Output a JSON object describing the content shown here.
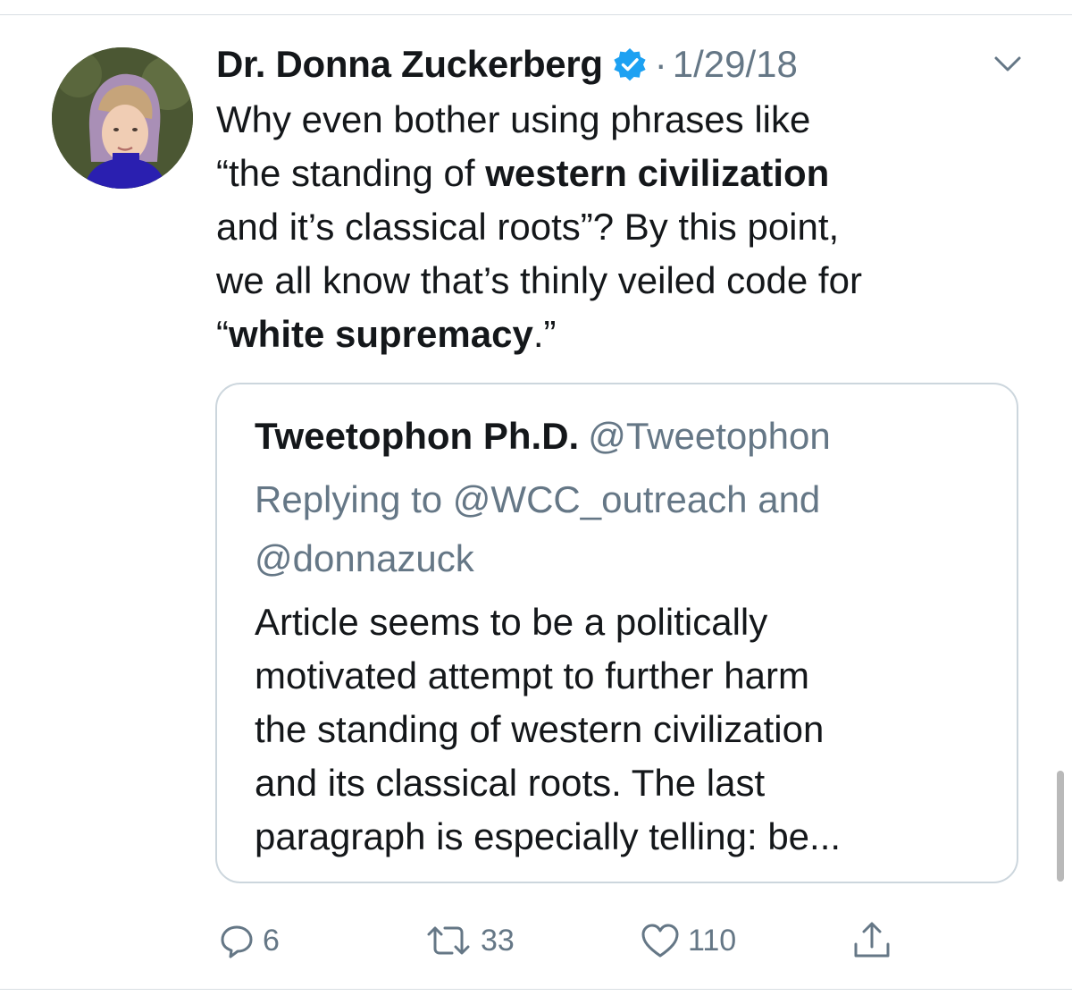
{
  "tweet": {
    "author_name": "Dr. Donna Zuckerberg",
    "separator": "·",
    "date": "1/29/18",
    "text": {
      "l1": "Why even bother using phrases like",
      "l2_pre": "“the standing of ",
      "l2_bold": "western civilization",
      "l3": "and it’s classical roots”? By this point,",
      "l4": "we all know that’s thinly veiled code for",
      "l5_pre": "“",
      "l5_bold": "white supremacy",
      "l5_post": ".”"
    }
  },
  "quote": {
    "name": "Tweetophon Ph.D.",
    "handle": "@Tweetophon",
    "reply_line1": "Replying to @WCC_outreach and",
    "reply_line2": "@donnazuck",
    "text_lines": [
      "Article seems to be a politically",
      "motivated attempt to further harm",
      "the standing of western civilization",
      "and its classical roots. The last",
      "paragraph is especially telling: be..."
    ]
  },
  "actions": {
    "replies": "6",
    "retweets": "33",
    "likes": "110"
  },
  "colors": {
    "text": "#14171a",
    "secondary": "#657786",
    "verified": "#1da1f2",
    "border": "#ccd6dd"
  },
  "icons": [
    "verified-badge-icon",
    "chevron-down-icon",
    "reply-icon",
    "retweet-icon",
    "like-icon",
    "share-icon"
  ]
}
